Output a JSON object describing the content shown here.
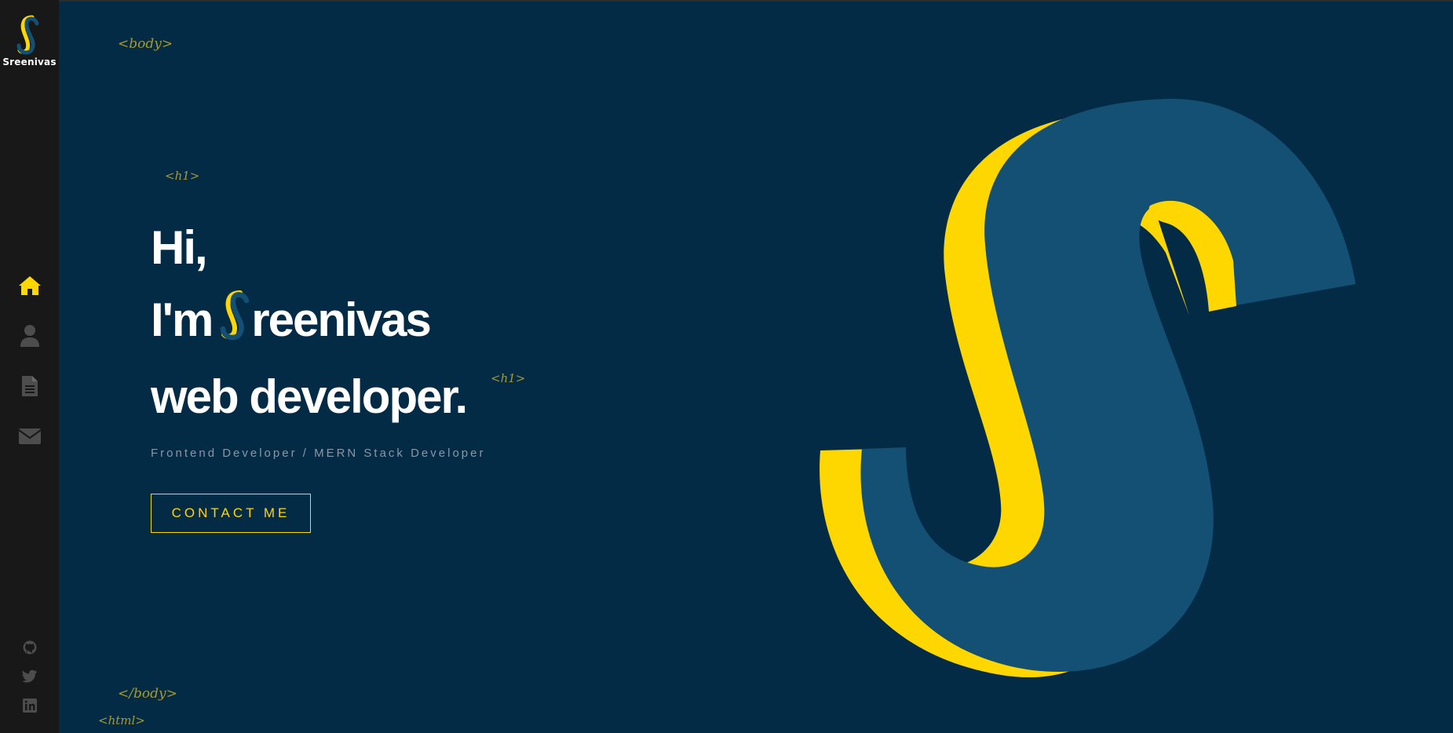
{
  "brand": {
    "name": "Sreenivas"
  },
  "nav": [
    {
      "name": "home",
      "icon": "home-icon",
      "active": true
    },
    {
      "name": "about",
      "icon": "user-icon",
      "active": false
    },
    {
      "name": "resume",
      "icon": "document-icon",
      "active": false
    },
    {
      "name": "contact",
      "icon": "envelope-icon",
      "active": false
    }
  ],
  "social": [
    {
      "name": "github",
      "icon": "github-icon"
    },
    {
      "name": "twitter",
      "icon": "twitter-icon"
    },
    {
      "name": "linkedin",
      "icon": "linkedin-icon"
    }
  ],
  "tags": {
    "body_open": "<body>",
    "h1_open": "<h1>",
    "h1_close": "<h1>",
    "body_close": "</body>",
    "html_close": "<html>"
  },
  "hero": {
    "line1": "Hi,",
    "line2_prefix": "I'm",
    "line2_name_rest": "reenivas",
    "line3": "web developer."
  },
  "subtitle": "Frontend Developer / MERN Stack Developer",
  "contact_button": "CONTACT ME",
  "colors": {
    "accent": "#ffd700",
    "background": "#042b45",
    "sidebar": "#181818",
    "s_blue": "#135074"
  }
}
